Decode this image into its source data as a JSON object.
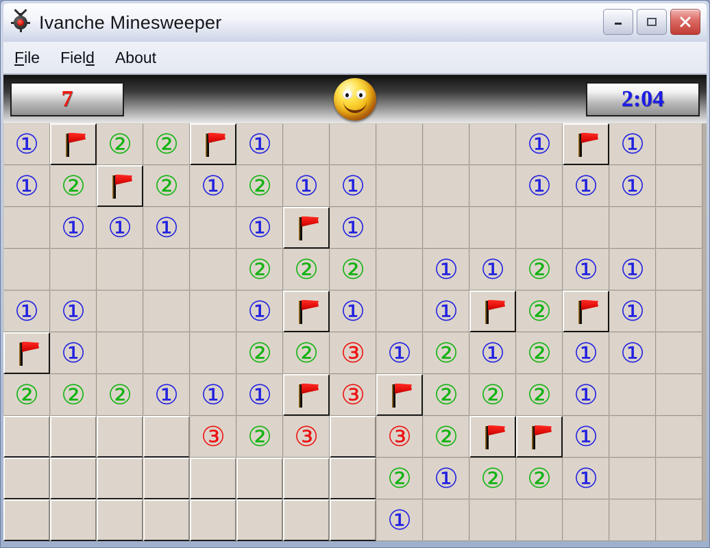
{
  "window": {
    "title": "Ivanche Minesweeper",
    "icon": "mine-icon",
    "controls": [
      {
        "name": "minimize",
        "glyph": "_"
      },
      {
        "name": "maximize",
        "glyph": "□"
      },
      {
        "name": "close",
        "glyph": "✕"
      }
    ]
  },
  "menu": [
    {
      "label": "File",
      "accel": "F"
    },
    {
      "label": "Field",
      "accel": "d"
    },
    {
      "label": "About",
      "accel": ""
    }
  ],
  "status": {
    "mine_count": "7",
    "timer": "2:04",
    "face": "smiley-face",
    "mine_count_color": "#ee1b12",
    "timer_color": "#1c1ce8"
  },
  "board": {
    "columns": 15,
    "rows": 10,
    "colors": {
      "one": "#2222e0",
      "two": "#13b313",
      "three": "#ec1414",
      "cell": "#dcd4ca",
      "flag": "#e00d0a"
    },
    "legend": {
      "e": "empty-revealed",
      "c": "covered",
      "F": "flag",
      "1": "one",
      "2": "two",
      "3": "three"
    },
    "cells": [
      [
        "1",
        "F",
        "2",
        "2",
        "F",
        "1",
        "e",
        "e",
        "e",
        "e",
        "e",
        "1",
        "F",
        "1",
        "e"
      ],
      [
        "1",
        "2",
        "F",
        "2",
        "1",
        "2",
        "1",
        "1",
        "e",
        "e",
        "e",
        "1",
        "1",
        "1",
        "e"
      ],
      [
        "e",
        "1",
        "1",
        "1",
        "e",
        "1",
        "F",
        "1",
        "e",
        "e",
        "e",
        "e",
        "e",
        "e",
        "e"
      ],
      [
        "e",
        "e",
        "e",
        "e",
        "e",
        "2",
        "2",
        "2",
        "e",
        "1",
        "1",
        "2",
        "1",
        "1",
        "e"
      ],
      [
        "1",
        "1",
        "e",
        "e",
        "e",
        "1",
        "F",
        "1",
        "e",
        "1",
        "F",
        "2",
        "F",
        "1",
        "e"
      ],
      [
        "F",
        "1",
        "e",
        "e",
        "e",
        "2",
        "2",
        "3",
        "1",
        "2",
        "1",
        "2",
        "1",
        "1",
        "e"
      ],
      [
        "2",
        "2",
        "2",
        "1",
        "1",
        "1",
        "F",
        "3",
        "F",
        "2",
        "2",
        "2",
        "1",
        "e",
        "e"
      ],
      [
        "c",
        "c",
        "c",
        "c",
        "3",
        "2",
        "3",
        "c",
        "3",
        "2",
        "F",
        "F",
        "1",
        "e",
        "e"
      ],
      [
        "c",
        "c",
        "c",
        "c",
        "c",
        "c",
        "c",
        "c",
        "2",
        "1",
        "2",
        "2",
        "1",
        "e",
        "e"
      ],
      [
        "c",
        "c",
        "c",
        "c",
        "c",
        "c",
        "c",
        "c",
        "1",
        "e",
        "e",
        "e",
        "e",
        "e",
        "e"
      ]
    ]
  }
}
